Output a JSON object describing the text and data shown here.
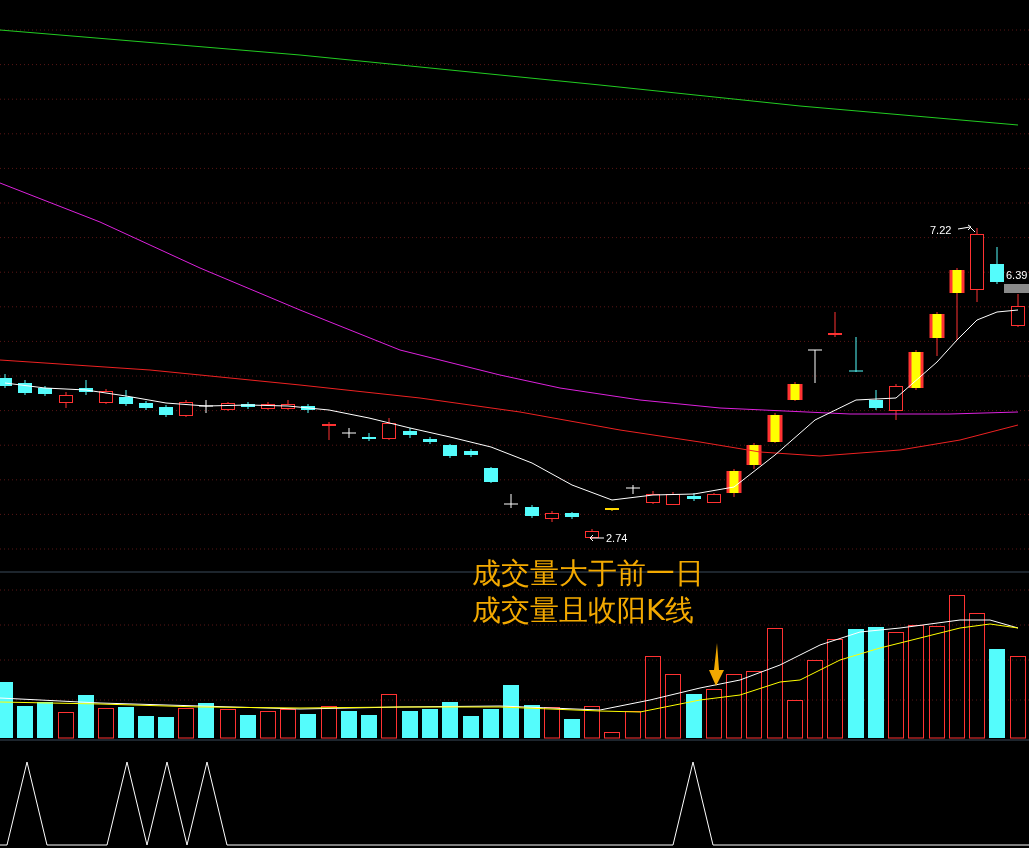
{
  "price_labels": {
    "high": "7.22",
    "last": "6.39",
    "low": "2.74"
  },
  "annotation": {
    "lines": [
      "成交量大于前一日",
      "成交量且收阳K线"
    ]
  }
}
